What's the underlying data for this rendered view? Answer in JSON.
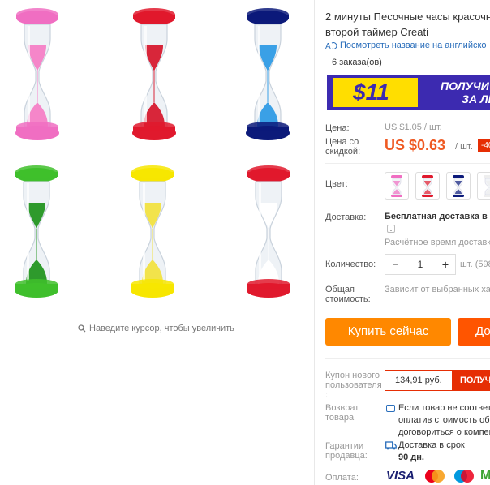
{
  "product": {
    "title_line1": "2 минуты Песочные часы красочн",
    "title_line2": "второй таймер Creati",
    "translate_link": "Посмотреть название на английско",
    "orders": "6 заказа(ов)"
  },
  "banner": {
    "amount": "$11",
    "text_line1": "ПОЛУЧИ",
    "text_line2": "ЗА ЛЕ"
  },
  "price": {
    "label": "Цена:",
    "old": "US $1.05 / шт.",
    "discount_label": "Цена со скидкой:",
    "new": "US $0.63",
    "unit": "/ шт.",
    "discount_badge": "-40"
  },
  "color": {
    "label": "Цвет:",
    "options": [
      {
        "name": "pink",
        "color": "#f06ec2"
      },
      {
        "name": "red",
        "color": "#e0192d"
      },
      {
        "name": "navy",
        "color": "#0c1a7a"
      },
      {
        "name": "white",
        "color": "#eeeeee"
      }
    ]
  },
  "shipping": {
    "label": "Доставка:",
    "value": "Бесплатная доставка в R",
    "estimate": "Расчётное время доставки"
  },
  "quantity": {
    "label": "Количество:",
    "value": "1",
    "minus": "−",
    "plus": "+",
    "available": "шт. (598"
  },
  "total": {
    "label_line1": "Общая",
    "label_line2": "стоимость:",
    "value": "Зависит от выбранных хар"
  },
  "actions": {
    "buy_now": "Купить сейчас",
    "add_to_cart": "До"
  },
  "coupon": {
    "label_line1": "Купон нового",
    "label_line2": "пользователя",
    "label_line3": ":",
    "value": "134,91 руб.",
    "button": "ПОЛУЧ"
  },
  "returns": {
    "label_line1": "Возврат",
    "label_line2": "товара",
    "line1": "Если товар не соответс",
    "line2": "оплатив стоимость обр",
    "line3": "договориться о компен"
  },
  "guarantee": {
    "label_line1": "Гарантии",
    "label_line2": "продавца:",
    "line1": "Доставка в срок",
    "line2": "90 дн."
  },
  "payment": {
    "label": "Оплата:",
    "visa": "VISA",
    "icons": [
      "mastercard-icon",
      "maestro-icon"
    ],
    "more": "M"
  },
  "gallery": {
    "zoom_hint": "Наведите курсор, чтобы увеличить",
    "hourglasses": [
      {
        "color": "#f06ec2",
        "sand": "#f586c9"
      },
      {
        "color": "#e0192d",
        "sand": "#d8263a"
      },
      {
        "color": "#0c1a7a",
        "sand": "#3aa0e6"
      },
      {
        "color": "#3fbf2c",
        "sand": "#2e9a2c"
      },
      {
        "color": "#f7e600",
        "sand": "#f2e34b"
      },
      {
        "color": "#e0192d",
        "sand": "#ffffff"
      }
    ]
  }
}
